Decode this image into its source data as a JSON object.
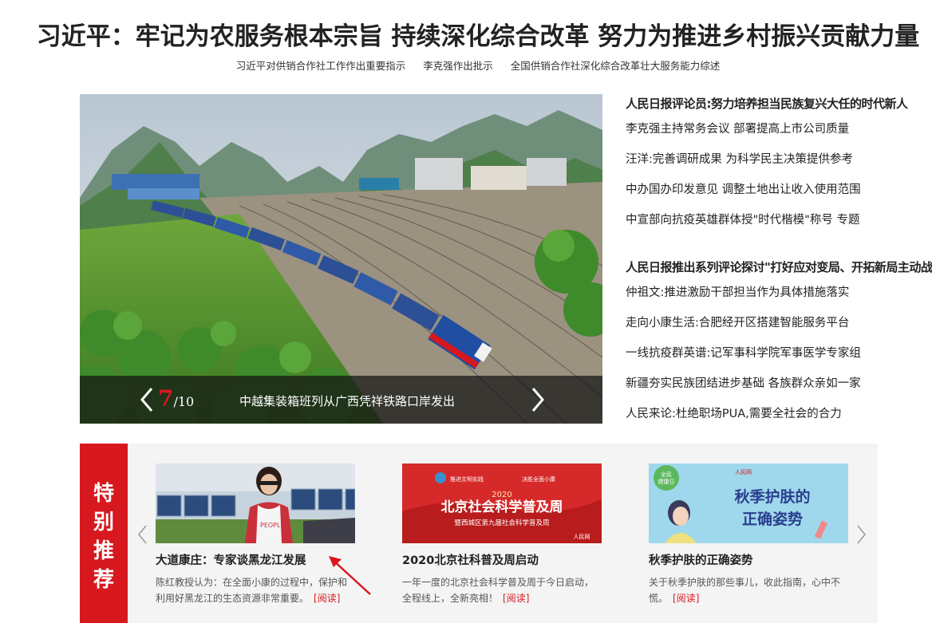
{
  "headline": "习近平：牢记为农服务根本宗旨 持续深化综合改革 努力为推进乡村振兴贡献力量",
  "subnav": [
    "习近平对供销合作社工作作出重要指示",
    "李克强作出批示",
    "全国供销合作社深化综合改革壮大服务能力综述"
  ],
  "carousel": {
    "current": "7",
    "total": "/10",
    "caption": "中越集装箱班列从广西凭祥铁路口岸发出",
    "prev_icon": "chevron-left-icon",
    "next_icon": "chevron-right-icon"
  },
  "news": {
    "headline1": "人民日报评论员:努力培养担当民族复兴大任的时代新人",
    "group1": [
      "李克强主持常务会议 部署提高上市公司质量",
      "汪洋:完善调研成果 为科学民主决策提供参考",
      "中办国办印发意见 调整土地出让收入使用范围",
      "中宣部向抗疫英雄群体授\"时代楷模\"称号 专题"
    ],
    "headline2": "人民日报推出系列评论探讨\"打好应对变局、开拓新局主动战\"",
    "group2": [
      "仲祖文:推进激励干部担当作为具体措施落实",
      "走向小康生活:合肥经开区搭建智能服务平台",
      "一线抗疫群英谱:记军事科学院军事医学专家组",
      "新疆夯实民族团结进步基础 各族群众亲如一家",
      "人民来论:杜绝职场PUA,需要全社会的合力"
    ]
  },
  "recommend": {
    "tag": [
      "特",
      "别",
      "推",
      "荐"
    ],
    "read_label": "[阅读]",
    "cards": [
      {
        "title": "大道康庄：专家谈黑龙江发展",
        "desc": "陈红教授认为：在全面小康的过程中，保护和利用好黑龙江的生态资源非常重要。",
        "thumb_text": "PEOPLE"
      },
      {
        "title": "2020北京社科普及周启动",
        "desc": "一年一度的北京社会科学普及周于今日启动，全程线上，全新亮相！",
        "banner_top1": "推进文明实践",
        "banner_top2": "决胜全面小康",
        "banner_year": "2020",
        "banner_title": "北京社会科学普及周",
        "banner_sub": "暨西城区第九届社会科学普及周",
        "banner_logo": "人民网"
      },
      {
        "title": "秋季护肤的正确姿势",
        "desc": "关于秋季护肤的那些事儿，收此指南，心中不慌。",
        "banner_line1": "秋季护肤的",
        "banner_line2": "正确姿势",
        "banner_badge1": "全民",
        "banner_badge2": "健康日",
        "banner_logo": "人民网"
      }
    ]
  },
  "colors": {
    "accent": "#d7181f",
    "rec_bg": "#f4f4f4"
  }
}
